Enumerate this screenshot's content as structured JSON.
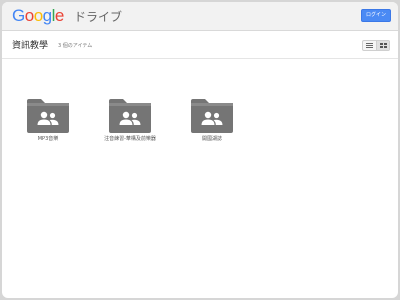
{
  "header": {
    "logo_letters": [
      {
        "char": "G",
        "color": "#4285f4"
      },
      {
        "char": "o",
        "color": "#ea4335"
      },
      {
        "char": "o",
        "color": "#fbbc05"
      },
      {
        "char": "g",
        "color": "#4285f4"
      },
      {
        "char": "l",
        "color": "#34a853"
      },
      {
        "char": "e",
        "color": "#ea4335"
      }
    ],
    "product_name": "ドライブ",
    "login_label": "ログイン"
  },
  "toolbar": {
    "title": "資訊教學",
    "item_count": "3 個のアイテム",
    "view_buttons": [
      {
        "icon": "list-view-icon",
        "active": false
      },
      {
        "icon": "grid-view-icon",
        "active": true
      }
    ]
  },
  "folders": [
    {
      "name": "MP3音樂",
      "icon": "shared-folder-icon"
    },
    {
      "name": "注音練習-華構及前樂器",
      "icon": "shared-folder-icon"
    },
    {
      "name": "開國湖誌",
      "icon": "shared-folder-icon"
    }
  ],
  "colors": {
    "folder": "#757575",
    "folder_tab": "#8a8a8a",
    "people": "#ffffff",
    "accent": "#4a8af4"
  }
}
